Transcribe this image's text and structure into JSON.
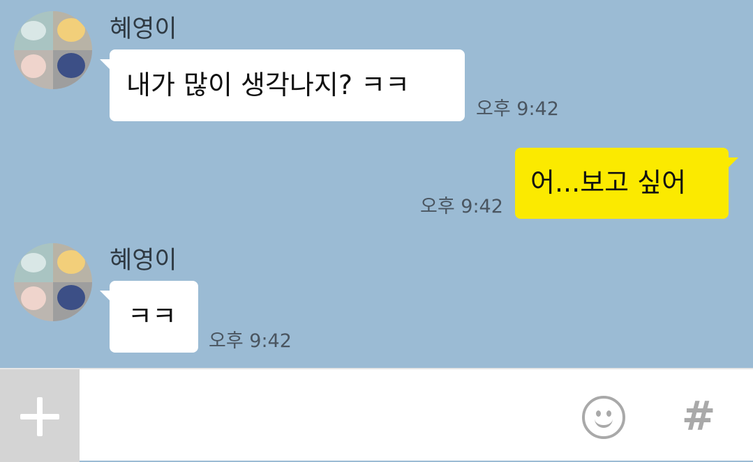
{
  "conversation": {
    "messages": [
      {
        "sender": "혜영이",
        "text": "내가 많이 생각나지? ㅋㅋ",
        "time": "오후 9:42",
        "direction": "incoming"
      },
      {
        "sender": "",
        "text": "어...보고 싶어",
        "time": "오후 9:42",
        "direction": "outgoing"
      },
      {
        "sender": "혜영이",
        "text": "ㅋㅋ",
        "time": "오후 9:42",
        "direction": "incoming"
      }
    ]
  },
  "input_bar": {
    "placeholder": "",
    "plus_icon": "plus-icon",
    "emoji_icon": "smiley-icon",
    "hash_icon": "hash-icon",
    "hash_glyph": "#"
  },
  "colors": {
    "chat_background": "#9bbbd4",
    "incoming_bubble": "#ffffff",
    "outgoing_bubble": "#fbea00",
    "plus_button_bg": "#d4d4d4"
  }
}
